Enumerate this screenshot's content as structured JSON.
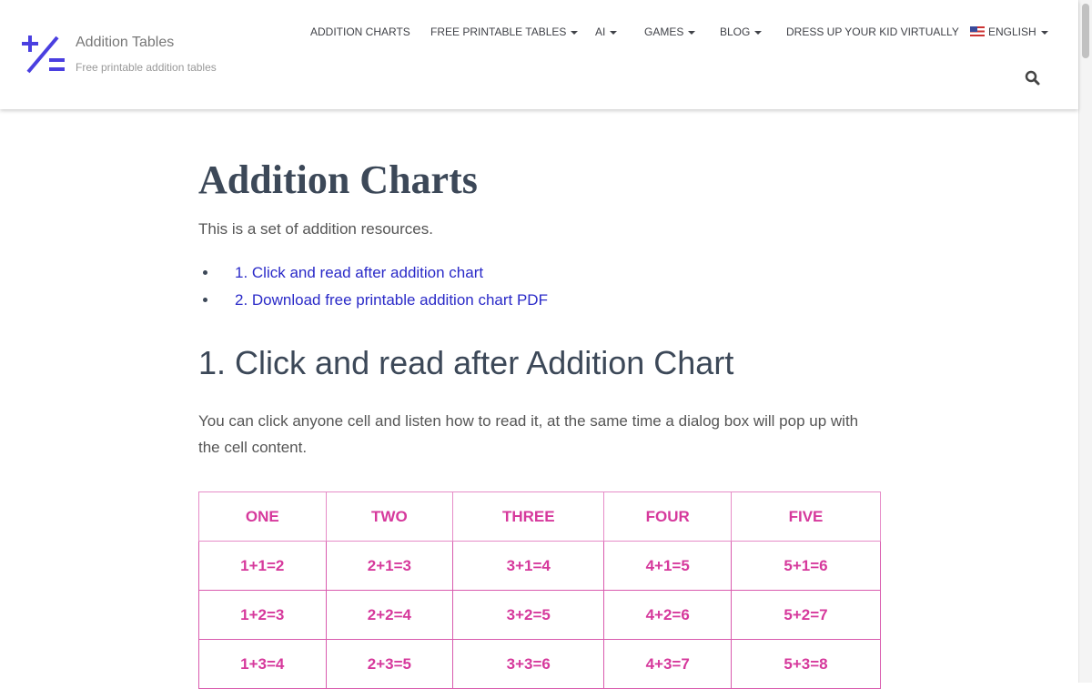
{
  "brand": {
    "title": "Addition Tables",
    "subtitle": "Free printable addition tables",
    "logo_color": "#4a3fe0"
  },
  "nav": [
    {
      "label": "ADDITION CHARTS",
      "dropdown": false
    },
    {
      "label": "FREE PRINTABLE TABLES",
      "dropdown": true
    },
    {
      "label": "AI",
      "dropdown": true
    },
    {
      "label": "GAMES",
      "dropdown": true
    },
    {
      "label": "BLOG",
      "dropdown": true
    },
    {
      "label": "DRESS UP YOUR KID VIRTUALLY",
      "dropdown": false
    },
    {
      "label": "ENGLISH",
      "dropdown": true,
      "icon": "us-flag-icon"
    }
  ],
  "main": {
    "title": "Addition Charts",
    "intro": "This is a set of addition resources.",
    "toc": [
      "1. Click and read after addition chart",
      "2. Download free printable addition chart PDF"
    ],
    "section_title": "1. Click and read after Addition Chart",
    "section_text": "You can click anyone cell and listen how to read it, at the same time a dialog box will pop up with the cell content.",
    "table": {
      "headers": [
        "ONE",
        "TWO",
        "THREE",
        "FOUR",
        "FIVE"
      ],
      "rows": [
        [
          "1+1=2",
          "2+1=3",
          "3+1=4",
          "4+1=5",
          "5+1=6"
        ],
        [
          "1+2=3",
          "2+2=4",
          "3+2=5",
          "4+2=6",
          "5+2=7"
        ],
        [
          "1+3=4",
          "2+3=5",
          "3+3=6",
          "4+3=7",
          "5+3=8"
        ]
      ],
      "color": "#d6399c"
    }
  }
}
